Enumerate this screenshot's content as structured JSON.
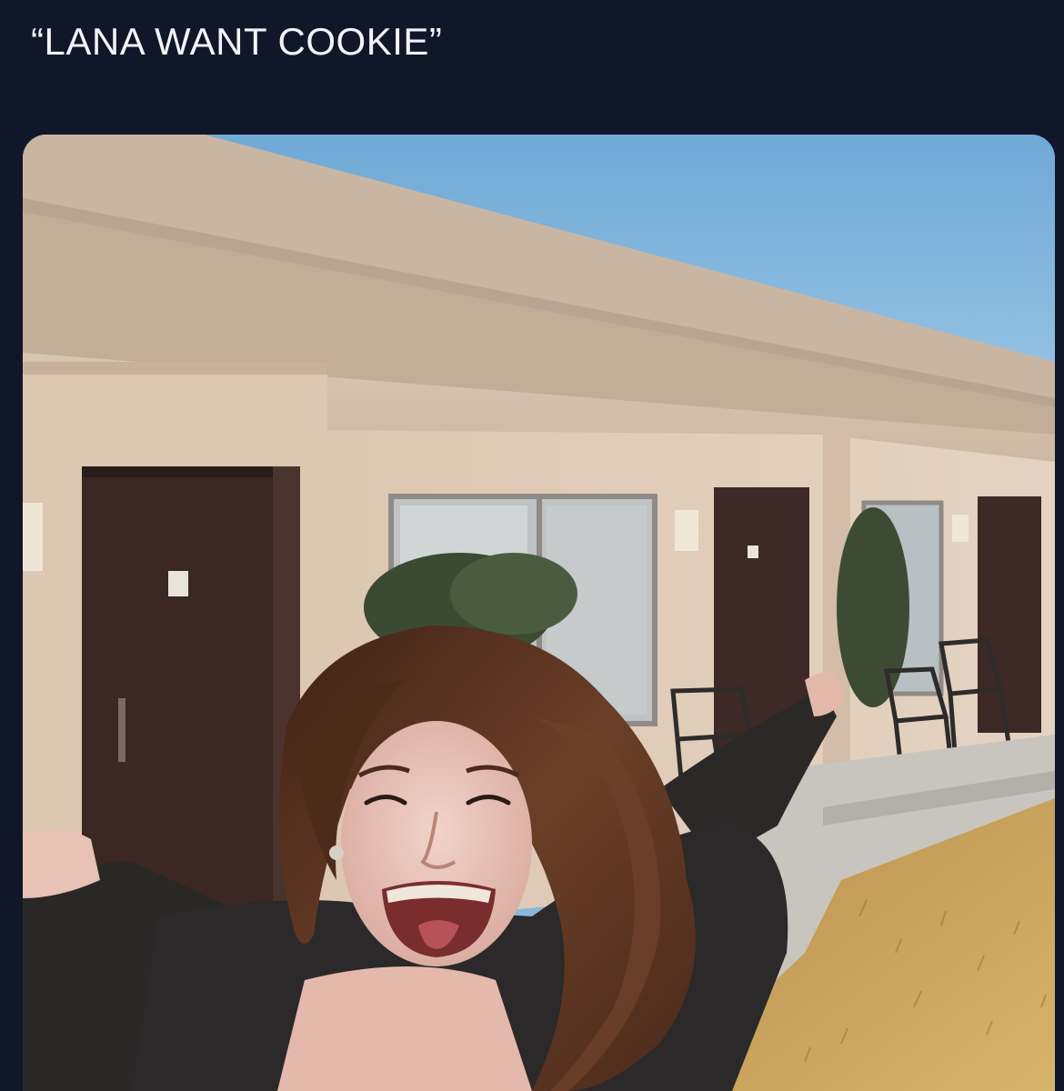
{
  "post": {
    "caption": "“LANA WANT COOKIE”"
  },
  "photo": {
    "scene": "woman-laughing-in-front-of-motel",
    "colors": {
      "background": "#101728",
      "sky": "#8dbfe0",
      "wall": "#d8c0a8",
      "roof": "#cbb8a2",
      "door": "#3e2a27",
      "hair": "#5a3522",
      "sweater": "#2a2828",
      "grass": "#c9a35c",
      "path": "#c7c5c0"
    }
  }
}
